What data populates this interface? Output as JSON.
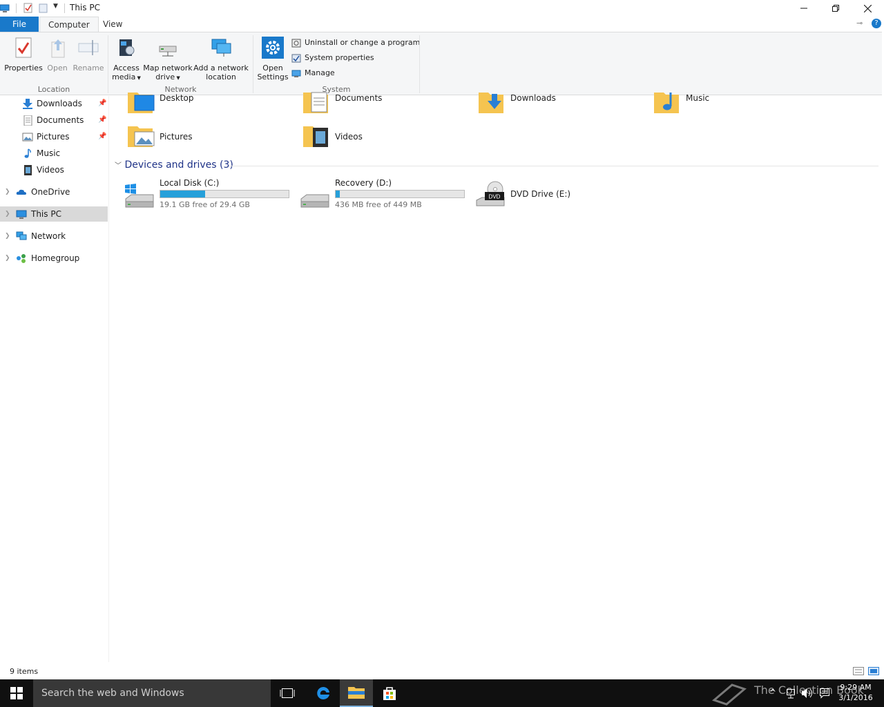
{
  "window": {
    "title": "This PC"
  },
  "ribbon": {
    "tabs": [
      {
        "label": "File"
      },
      {
        "label": "Computer"
      },
      {
        "label": "View"
      }
    ],
    "groups": {
      "location": {
        "label": "Location",
        "properties": "Properties",
        "open": "Open",
        "rename": "Rename"
      },
      "network": {
        "label": "Network",
        "access_media": [
          "Access",
          "media"
        ],
        "map_drive": [
          "Map network",
          "drive"
        ],
        "add_location": [
          "Add a network",
          "location"
        ]
      },
      "system": {
        "label": "System",
        "open_settings": [
          "Open",
          "Settings"
        ],
        "uninstall": "Uninstall or change a program",
        "system_properties": "System properties",
        "manage": "Manage"
      }
    }
  },
  "nav": {
    "quick": [
      {
        "label": "Downloads"
      },
      {
        "label": "Documents"
      },
      {
        "label": "Pictures"
      },
      {
        "label": "Music"
      },
      {
        "label": "Videos"
      }
    ],
    "roots": [
      {
        "label": "OneDrive"
      },
      {
        "label": "This PC"
      },
      {
        "label": "Network"
      },
      {
        "label": "Homegroup"
      }
    ]
  },
  "content": {
    "folders": [
      {
        "label": "Desktop"
      },
      {
        "label": "Documents"
      },
      {
        "label": "Downloads"
      },
      {
        "label": "Music"
      },
      {
        "label": "Pictures"
      },
      {
        "label": "Videos"
      }
    ],
    "devices_header": "Devices and drives (3)",
    "drives": [
      {
        "name": "Local Disk (C:)",
        "free": "19.1 GB free of 29.4 GB",
        "used_fraction": 0.35
      },
      {
        "name": "Recovery (D:)",
        "free": "436 MB free of 449 MB",
        "used_fraction": 0.03
      },
      {
        "name": "DVD Drive (E:)"
      }
    ],
    "dvd_badge": "DVD"
  },
  "status": {
    "items": "9 items"
  },
  "taskbar": {
    "search_placeholder": "Search the web and Windows",
    "time": "9:29 AM",
    "date": "3/1/2016",
    "watermark": "The Collection Book"
  },
  "colors": {
    "accent": "#1979ca",
    "bar_fill": "#26a0da",
    "folder": "#f5c450"
  }
}
